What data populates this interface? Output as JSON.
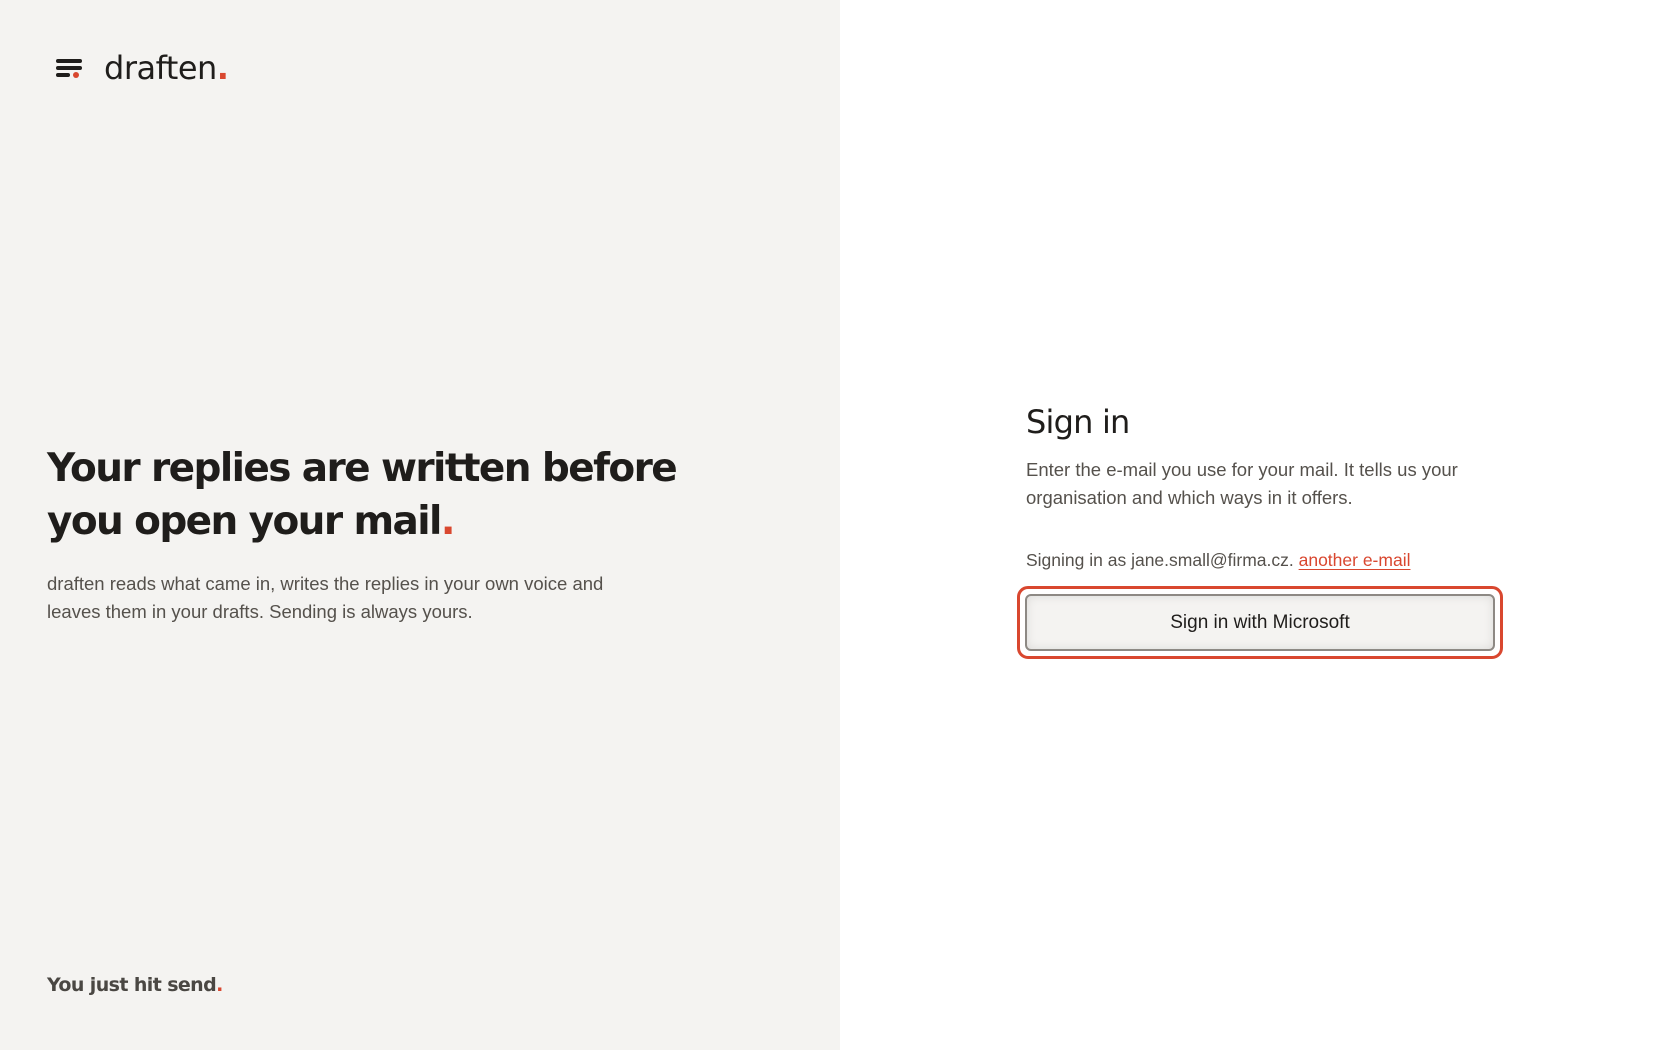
{
  "colors": {
    "accent": "#d9472f",
    "left_background": "#f4f3f1",
    "right_background": "#ffffff",
    "text_primary": "#1f1d1b",
    "text_secondary": "#55514c"
  },
  "brand": {
    "menu_icon": "menu-lines-icon",
    "name": "draften",
    "dot": "."
  },
  "hero": {
    "title_line1": "Your replies are written before",
    "title_line2": "you open your mail",
    "title_dot": ".",
    "description": "draften reads what came in, writes the replies in your own voice and leaves them in your drafts. Sending is always yours."
  },
  "footer": {
    "tagline": "You just hit send",
    "dot": "."
  },
  "signin": {
    "title": "Sign in",
    "description": "Enter the e-mail you use for your mail. It tells us your organisation and which ways in it offers.",
    "signing_as_prefix": "Signing in as jane.small@firma.cz.",
    "change_email_link": "another e-mail",
    "microsoft_button": "Sign in with Microsoft"
  }
}
